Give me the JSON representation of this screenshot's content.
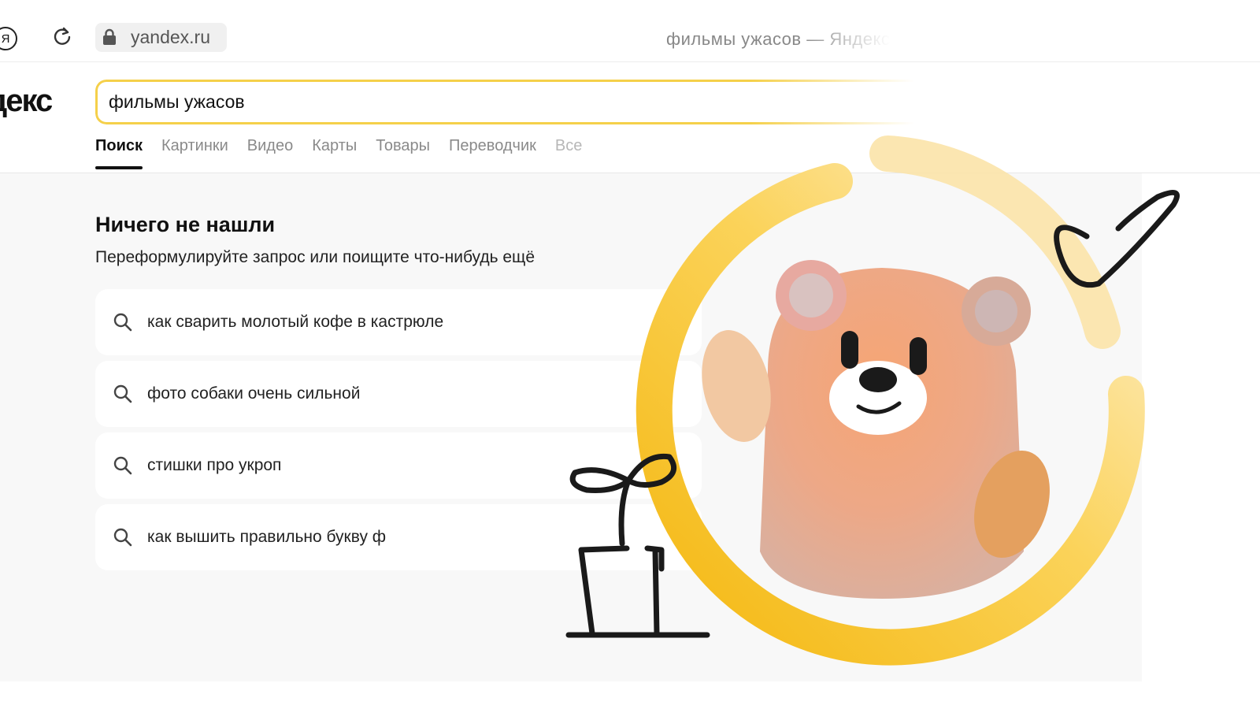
{
  "browser": {
    "yandex_button": "Я",
    "url": "yandex.ru",
    "tab_title": "фильмы ужасов — Яндекс"
  },
  "header": {
    "logo": "Яндекс",
    "search_value": "фильмы ужасов"
  },
  "tabs": [
    {
      "label": "Поиск"
    },
    {
      "label": "Картинки"
    },
    {
      "label": "Видео"
    },
    {
      "label": "Карты"
    },
    {
      "label": "Товары"
    },
    {
      "label": "Переводчик"
    },
    {
      "label": "Все"
    }
  ],
  "main": {
    "title": "Ничего не нашли",
    "subtitle": "Переформулируйте запрос или поищите что-нибудь ещё",
    "suggestions": [
      {
        "text": "как сварить молотый кофе в кастрюле"
      },
      {
        "text": "фото собаки очень сильной"
      },
      {
        "text": "стишки про укроп"
      },
      {
        "text": "как вышить правильно букву ф"
      }
    ]
  },
  "colors": {
    "accent": "#f5d04a",
    "ring": "#f7c21e",
    "bear": "#f2a06a"
  },
  "icons": [
    "yandex-icon",
    "reload-icon",
    "lock-icon",
    "search-icon",
    "bear-mascot-icon",
    "checkmark-doodle-icon",
    "sprout-doodle-icon"
  ]
}
